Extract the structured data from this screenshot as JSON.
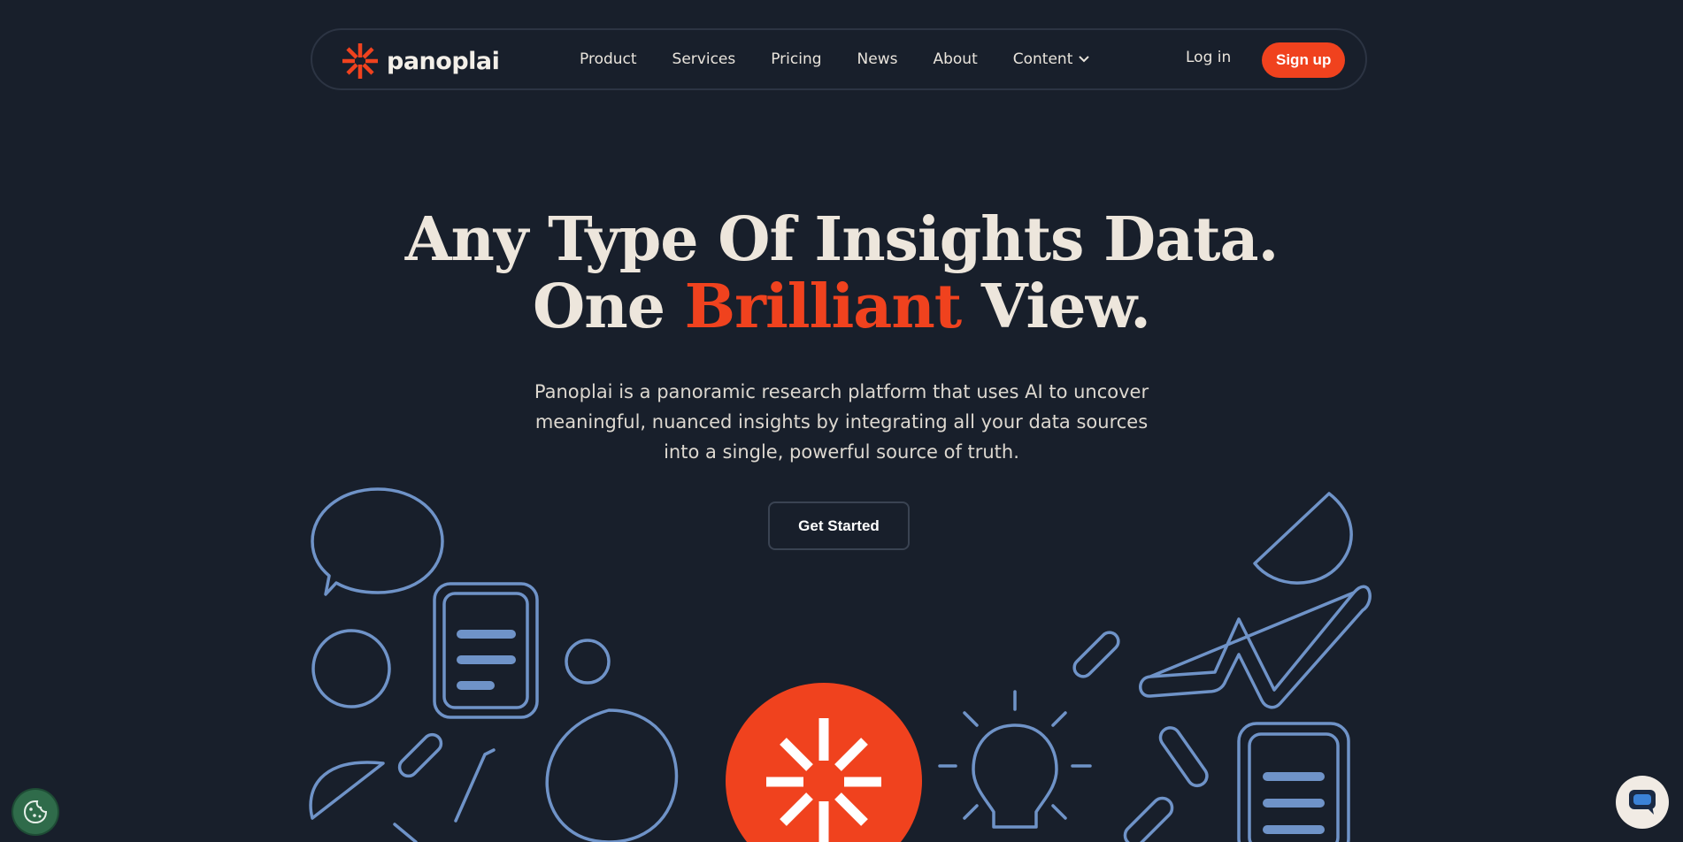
{
  "brand": {
    "name": "panoplai",
    "accent_color": "#f0421e",
    "background": "#181f2b",
    "outline_color": "#6f93c8"
  },
  "nav": {
    "links": [
      "Product",
      "Services",
      "Pricing",
      "News",
      "About",
      "Content"
    ],
    "login_label": "Log in",
    "signup_label": "Sign up"
  },
  "hero": {
    "title_line1": "Any Type Of Insights Data.",
    "title_line2_start": "One",
    "title_line2_accent": "Brilliant",
    "title_line2_end": "View.",
    "subtitle_line1": "Panoplai is a panoramic research platform that uses AI to uncover",
    "subtitle_line2": "meaningful, nuanced insights by integrating all your data sources",
    "subtitle_line3": "into a single, powerful source of truth.",
    "cta_label": "Get Started"
  },
  "icons": {
    "logo": "starburst-logo-icon",
    "dropdown": "chevron-down-icon",
    "cookie": "cookie-icon",
    "chat": "chat-bubble-icon"
  }
}
